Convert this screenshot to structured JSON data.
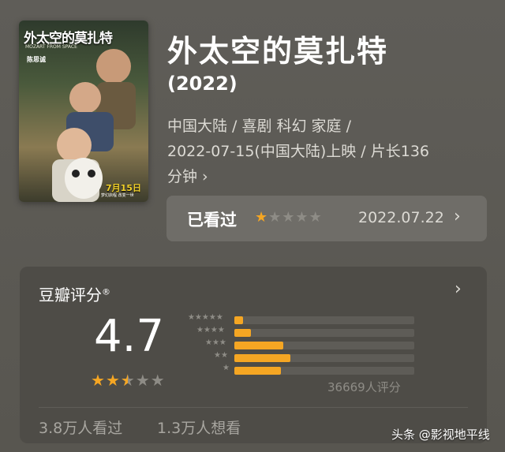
{
  "poster": {
    "title": "外太空的莫扎特",
    "subtitle": "MOZART FROM SPACE",
    "cast": "陈思诚",
    "date": "7月15日",
    "tagline": "梦幻启程 改变一世"
  },
  "movie": {
    "title": "外太空的莫扎特",
    "year": "(2022)",
    "meta_line1": "中国大陆 / 喜剧 科幻 家庭 /",
    "meta_line2": "2022-07-15(中国大陆)上映 / 片长136",
    "meta_line3": "分钟 ›"
  },
  "watched": {
    "label": "已看过",
    "user_rating_stars": 1,
    "date": "2022.07.22",
    "chevron": "›"
  },
  "rating": {
    "title": "豆瓣评分",
    "registered_mark": "®",
    "score": "4.7",
    "score_stars": 2.5,
    "count_label": "36669人评分",
    "chevron": "›",
    "distribution": [
      {
        "stars": 5,
        "percent": 5
      },
      {
        "stars": 4,
        "percent": 9
      },
      {
        "stars": 3,
        "percent": 27
      },
      {
        "stars": 2,
        "percent": 31
      },
      {
        "stars": 1,
        "percent": 26
      }
    ],
    "seen": "3.8万人看过",
    "want": "1.3万人想看"
  },
  "watermark": "头条 @影视地平线",
  "colors": {
    "accent": "#f5a623",
    "background": "#5c5a55",
    "card": "#4e4c47"
  }
}
